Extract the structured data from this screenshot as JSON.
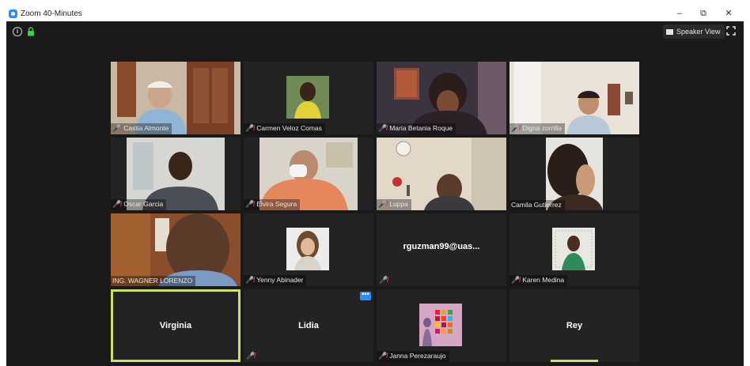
{
  "window": {
    "title": "Zoom 40-Minutes"
  },
  "window_controls": {
    "minimize": "–",
    "restore": "⧉",
    "close": "✕"
  },
  "toolbar": {
    "speaker_view_label": "Speaker View"
  },
  "tiles": [
    {
      "name": "Castia Almonte"
    },
    {
      "name": "Carmen Veloz Comas"
    },
    {
      "name": "Maria Betania Roque"
    },
    {
      "name": "Digna zorrilla"
    },
    {
      "name": "Oscar Garcia"
    },
    {
      "name": "Elvira Segura"
    },
    {
      "name": "Luppa"
    },
    {
      "name": "Camila Gutierrez"
    },
    {
      "name": "ING. WAGNER LORENZO"
    },
    {
      "name": "Yenny Abinader"
    },
    {
      "name": "rguzman99@uas..."
    },
    {
      "name": "Karen Medina"
    },
    {
      "name": "Virginia"
    },
    {
      "name": "Lidia"
    },
    {
      "name": "Janna Perezaraujo"
    },
    {
      "name": "Rey"
    }
  ],
  "tile_more_icon": "•••",
  "colors": {
    "active_speaker": "#c9e265",
    "mic_muted": "#e03a3a",
    "accent": "#2d8cff",
    "background": "#1a1a1a"
  }
}
